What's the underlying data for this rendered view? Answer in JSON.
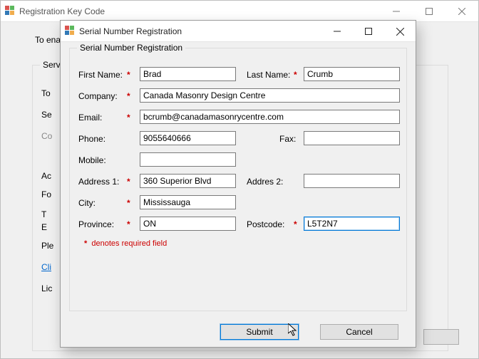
{
  "outer": {
    "title": "Registration Key Code",
    "enable_label": "To enab",
    "group_title": "Server",
    "lines": {
      "to": "To",
      "se": "Se",
      "co": "Co",
      "ac": "Ac",
      "fo": "Fo",
      "t": "T",
      "e": "E",
      "ple": "Ple",
      "cli": "Cli",
      "lic": "Lic"
    }
  },
  "dialog": {
    "title": "Serial Number Registration",
    "group_title": "Serial Number Registration",
    "labels": {
      "first_name": "First Name:",
      "last_name": "Last Name:",
      "company": "Company:",
      "email": "Email:",
      "phone": "Phone:",
      "fax": "Fax:",
      "mobile": "Mobile:",
      "address1": "Address 1:",
      "address2": "Addres 2:",
      "city": "City:",
      "province": "Province:",
      "postcode": "Postcode:"
    },
    "values": {
      "first_name": "Brad",
      "last_name": "Crumb",
      "company": "Canada Masonry Design Centre",
      "email": "bcrumb@canadamasonrycentre.com",
      "phone": "9055640666",
      "fax": "",
      "mobile": "",
      "address1": "360 Superior Blvd",
      "address2": "",
      "city": "Mississauga",
      "province": "ON",
      "postcode": "L5T2N7"
    },
    "required_mark": "*",
    "required_note": "denotes required field",
    "buttons": {
      "submit": "Submit",
      "cancel": "Cancel"
    }
  }
}
